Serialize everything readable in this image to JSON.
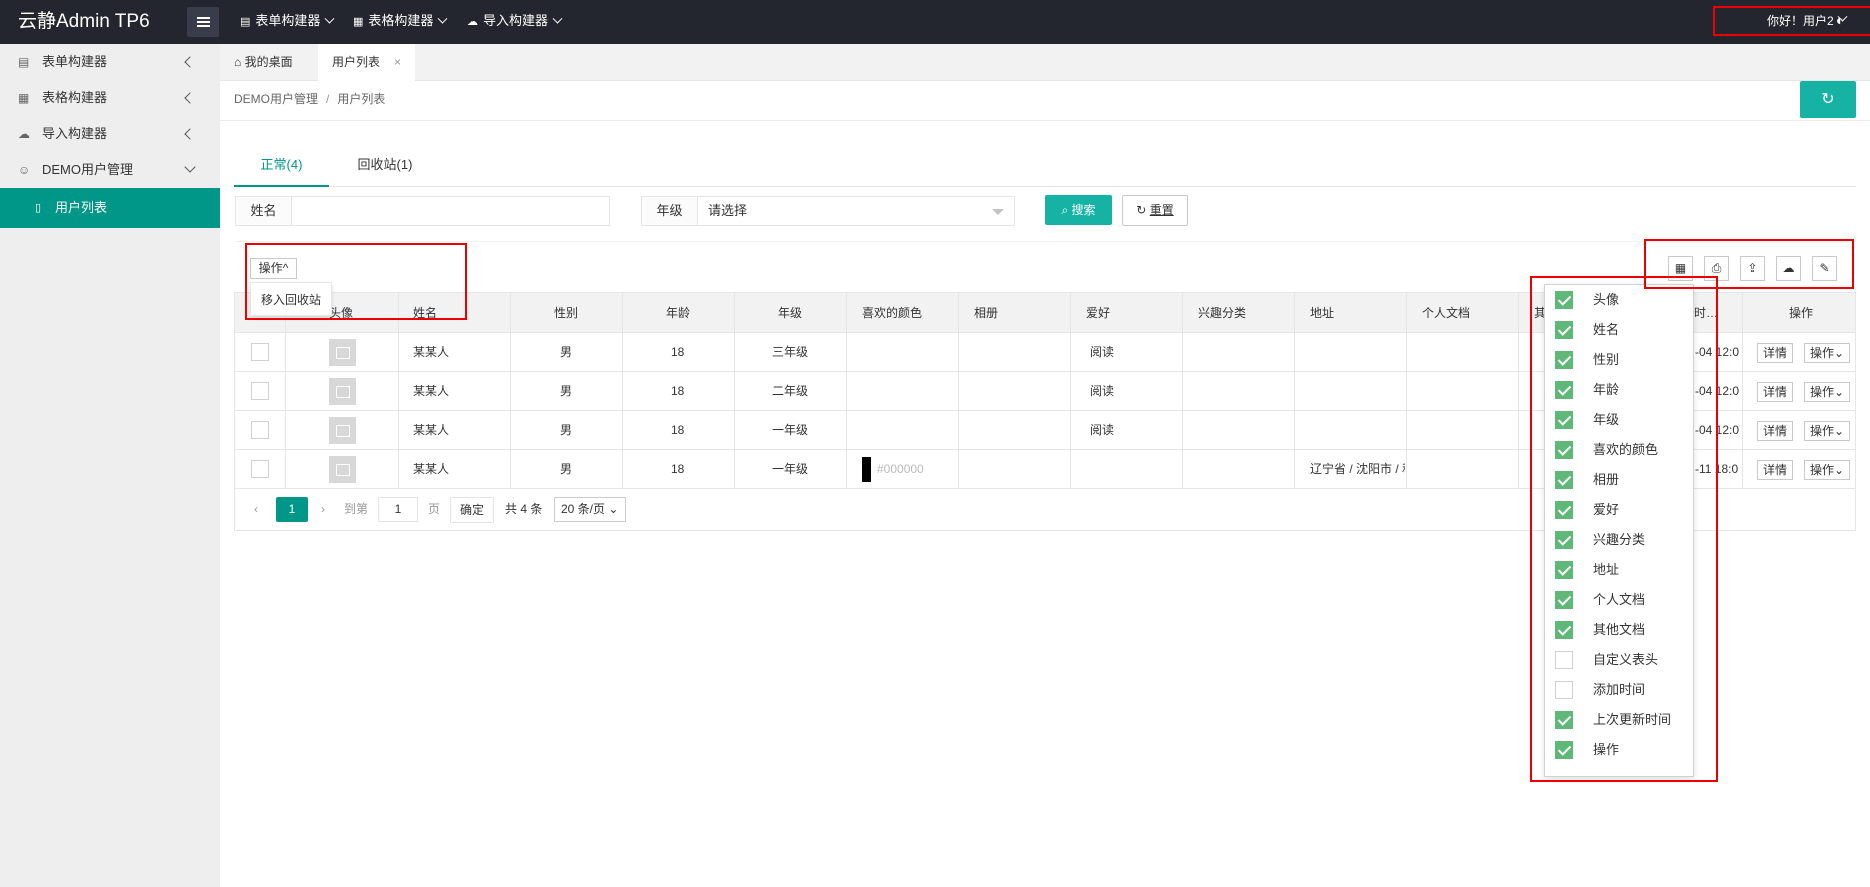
{
  "app": {
    "title": "云静Admin TP6"
  },
  "topnav": [
    {
      "label": "表单构建器",
      "icon": "form-icon"
    },
    {
      "label": "表格构建器",
      "icon": "table-icon"
    },
    {
      "label": "导入构建器",
      "icon": "cloud-upload-icon"
    }
  ],
  "user": {
    "greeting": "你好！用户2"
  },
  "sidebar": {
    "items": [
      {
        "label": "表单构建器",
        "icon": "form-icon"
      },
      {
        "label": "表格构建器",
        "icon": "table-icon"
      },
      {
        "label": "导入构建器",
        "icon": "cloud-upload-icon"
      },
      {
        "label": "DEMO用户管理",
        "icon": "user-icon"
      }
    ],
    "active": {
      "label": "用户列表",
      "icon": "file-icon"
    }
  },
  "tabs": [
    {
      "label": "我的桌面"
    },
    {
      "label": "用户列表",
      "close": "×"
    }
  ],
  "breadcrumb": {
    "parent": "DEMO用户管理",
    "sep": "/",
    "current": "用户列表"
  },
  "content_tabs": [
    {
      "label": "正常(4)"
    },
    {
      "label": "回收站(1)"
    }
  ],
  "filters": {
    "name_label": "姓名",
    "grade_label": "年级",
    "grade_placeholder": "请选择",
    "search_label": "搜索",
    "reset_label": "重置"
  },
  "toolbar": {
    "op_label": "操作",
    "op_dropdown_item": "移入回收站"
  },
  "table": {
    "headers": [
      "头像",
      "姓名",
      "性别",
      "年龄",
      "年级",
      "喜欢的颜色",
      "相册",
      "爱好",
      "兴趣分类",
      "地址",
      "个人文档",
      "其",
      "时…",
      "操作"
    ],
    "rows": [
      {
        "name": "某某人",
        "gender": "男",
        "age": "18",
        "grade": "三年级",
        "color": "",
        "hobby": "阅读",
        "address": "",
        "time": "-04 12:0",
        "detail": "详情",
        "op": "操作"
      },
      {
        "name": "某某人",
        "gender": "男",
        "age": "18",
        "grade": "二年级",
        "color": "",
        "hobby": "阅读",
        "address": "",
        "time": "-04 12:0",
        "detail": "详情",
        "op": "操作"
      },
      {
        "name": "某某人",
        "gender": "男",
        "age": "18",
        "grade": "一年级",
        "color": "",
        "hobby": "阅读",
        "address": "",
        "time": "-04 12:0",
        "detail": "详情",
        "op": "操作"
      },
      {
        "name": "某某人",
        "gender": "男",
        "age": "18",
        "grade": "一年级",
        "color": "#000000",
        "hobby": "",
        "address": "辽宁省 / 沈阳市 / 和",
        "time": "-11 18:0",
        "detail": "详情",
        "op": "操作"
      }
    ]
  },
  "pager": {
    "prev": "‹",
    "current": "1",
    "next": "›",
    "goto": "到第",
    "page_value": "1",
    "page_unit": "页",
    "confirm": "确定",
    "total": "共 4 条",
    "page_size": "20 条/页"
  },
  "column_panel": [
    {
      "label": "头像",
      "checked": true
    },
    {
      "label": "姓名",
      "checked": true
    },
    {
      "label": "性别",
      "checked": true
    },
    {
      "label": "年龄",
      "checked": true
    },
    {
      "label": "年级",
      "checked": true
    },
    {
      "label": "喜欢的颜色",
      "checked": true
    },
    {
      "label": "相册",
      "checked": true
    },
    {
      "label": "爱好",
      "checked": true
    },
    {
      "label": "兴趣分类",
      "checked": true
    },
    {
      "label": "地址",
      "checked": true
    },
    {
      "label": "个人文档",
      "checked": true
    },
    {
      "label": "其他文档",
      "checked": true
    },
    {
      "label": "自定义表头",
      "checked": false
    },
    {
      "label": "添加时间",
      "checked": false
    },
    {
      "label": "上次更新时间",
      "checked": true
    },
    {
      "label": "操作",
      "checked": true
    }
  ],
  "colors": {
    "topbar": "#23262e",
    "primary": "#009688",
    "accent": "#16b3a4",
    "check": "#5fb878",
    "highlight": "#ee0000"
  }
}
